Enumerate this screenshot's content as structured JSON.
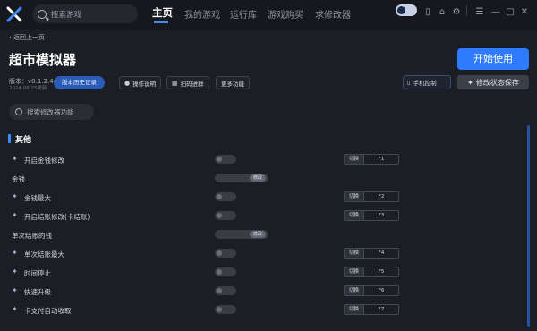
{
  "topbar": {
    "search_placeholder": "搜索游戏",
    "nav": [
      "主页",
      "我的游戏",
      "运行库",
      "游戏购买",
      "求修改器"
    ],
    "active_nav": "主页"
  },
  "header": {
    "back_label": "返回上一页",
    "title": "超市模拟器",
    "version": "版本：v0.1.2.4",
    "date": "2024.06.25更新",
    "history_button": "版本历史记录",
    "tools": [
      "操作说明",
      "扫码进群",
      "更多功能"
    ],
    "start_button": "开始使用",
    "phone_button": "手机控制",
    "save_button": "修改状态保存"
  },
  "feature_search_placeholder": "搜索修改器功能",
  "section_title": "其他",
  "rows": [
    {
      "label": "开启金钱修改",
      "type": "toggle",
      "switch_label": "切换",
      "key": "F1"
    },
    {
      "label": "金钱",
      "type": "modify",
      "modify_label": "修改"
    },
    {
      "label": "金钱最大",
      "type": "toggle",
      "switch_label": "切换",
      "key": "F2"
    },
    {
      "label": "开启结账修改(卡结账)",
      "type": "toggle",
      "switch_label": "切换",
      "key": "F3"
    },
    {
      "label": "单次结账的钱",
      "type": "modify",
      "modify_label": "修改"
    },
    {
      "label": "单次结账最大",
      "type": "toggle",
      "switch_label": "切换",
      "key": "F4"
    },
    {
      "label": "时间停止",
      "type": "toggle",
      "switch_label": "切换",
      "key": "F5"
    },
    {
      "label": "快速升级",
      "type": "toggle",
      "switch_label": "切换",
      "key": "F6"
    },
    {
      "label": "卡支付自动收取",
      "type": "toggle",
      "switch_label": "切换",
      "key": "F7"
    }
  ],
  "colors": {
    "accent": "#2f7bff",
    "background": "#1b1e24"
  }
}
